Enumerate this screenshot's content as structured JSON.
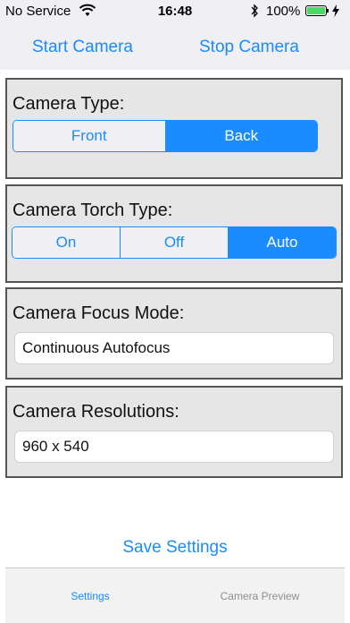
{
  "status_bar": {
    "carrier": "No Service",
    "time": "16:48",
    "battery_percent": "100%",
    "battery_color": "#4cd964"
  },
  "toolbar": {
    "start_label": "Start Camera",
    "stop_label": "Stop Camera"
  },
  "camera_type": {
    "label": "Camera Type:",
    "options": [
      "Front",
      "Back"
    ],
    "selected": "Back"
  },
  "torch_type": {
    "label": "Camera Torch Type:",
    "options": [
      "On",
      "Off",
      "Auto"
    ],
    "selected": "Auto"
  },
  "focus_mode": {
    "label": "Camera Focus Mode:",
    "value": "Continuous Autofocus"
  },
  "resolution": {
    "label": "Camera Resolutions:",
    "value": "960 x 540"
  },
  "save_label": "Save Settings",
  "tabs": {
    "settings": "Settings",
    "preview": "Camera Preview"
  },
  "colors": {
    "accent": "#1a8cff",
    "panel_bg": "#e6e6e6",
    "panel_border": "#555555"
  }
}
